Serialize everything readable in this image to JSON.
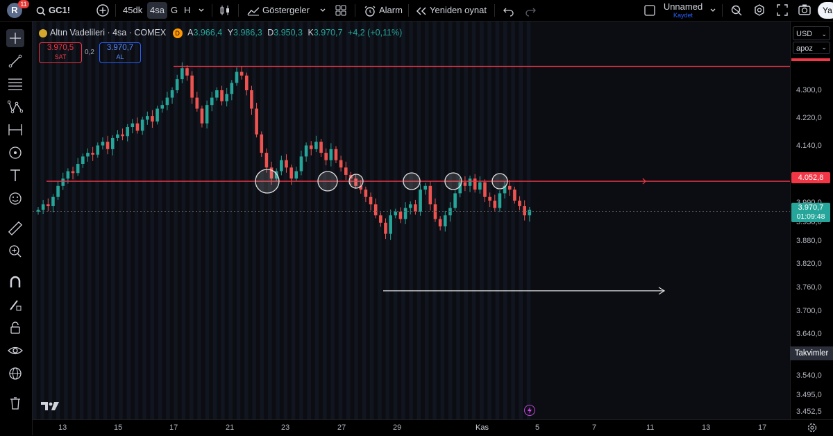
{
  "topbar": {
    "avatar_letter": "R",
    "notif_count": "11",
    "symbol": "GC1!",
    "intervals": [
      "45dk",
      "4sa",
      "G",
      "H"
    ],
    "indicators_label": "Göstergeler",
    "alarm_label": "Alarm",
    "replay_label": "Yeniden oynat",
    "layout_name": "Unnamed",
    "layout_saved": "Kaydet",
    "publish_label": "Ya"
  },
  "legend": {
    "title": "Altın Vadelileri · 4sa · COMEX",
    "badge": "D",
    "ohlc": {
      "open_label": "A",
      "open": "3.966,4",
      "high_label": "Y",
      "high": "3.986,3",
      "low_label": "D",
      "low": "3.950,3",
      "close_label": "K",
      "close": "3.970,7",
      "change": "+4,2 (+0,11%)"
    },
    "sell_price": "3.970,5",
    "sell_label": "SAT",
    "spread": "0,2",
    "buy_price": "3.970,7",
    "buy_label": "AL"
  },
  "price_axis": {
    "currency": "USD",
    "scale_mode": "apoz",
    "labels": [
      "4.300,0",
      "4.220,0",
      "4.140,0",
      "3.880,0",
      "3.820,0",
      "3.760,0",
      "3.700,0",
      "3.640,0",
      "3.540,0",
      "3.495,0",
      "3.452,5"
    ],
    "partial_labels": [
      "3.930,0",
      "3.990,0"
    ],
    "level_tag": "4.052,8",
    "last_price_tag": "3.970,7",
    "countdown": "01:09:48",
    "takvimler_label": "Takvimler"
  },
  "time_axis": {
    "labels": [
      "13",
      "15",
      "17",
      "21",
      "23",
      "27",
      "29",
      "Kas",
      "5",
      "7",
      "11",
      "13",
      "17"
    ]
  },
  "chart_data": {
    "type": "candlestick",
    "symbol": "GC1!",
    "interval": "4sa",
    "ylim": [
      3452.5,
      4380
    ],
    "last_price": 3970.7,
    "horizontal_levels": [
      4365,
      4052.8
    ],
    "colors": {
      "up": "#26a69a",
      "down": "#ef5350",
      "level_line": "#f23645",
      "background": "#0b0d12"
    }
  },
  "colors": {
    "accent": "#2962ff",
    "sell": "#f23645",
    "buy": "#2962ff",
    "last_price_bg": "#26a69a"
  }
}
